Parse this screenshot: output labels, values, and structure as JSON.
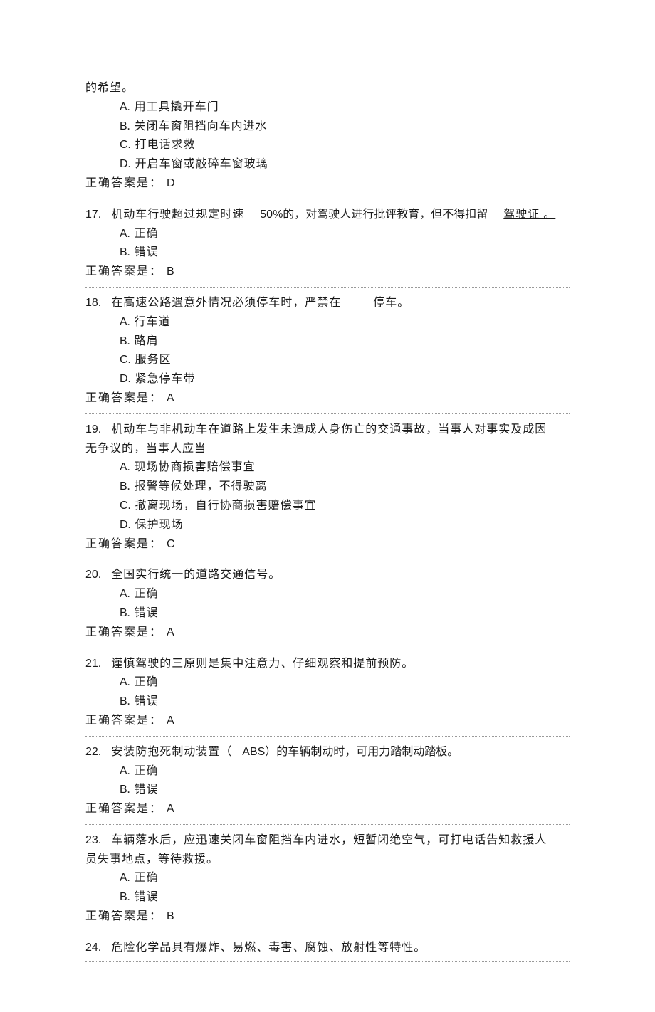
{
  "fragment_lead": "的希望。",
  "ans_label_prefix": "正确答案是：",
  "questions": [
    {
      "num": null,
      "text": "",
      "options": [
        {
          "k": "A",
          "t": "用工具撬开车门"
        },
        {
          "k": "B",
          "t": "关闭车窗阻挡向车内进水"
        },
        {
          "k": "C",
          "t": "打电话求救"
        },
        {
          "k": "D",
          "t": "开启车窗或敲碎车窗玻璃"
        }
      ],
      "answer": "D"
    },
    {
      "num": "17.",
      "text_parts": [
        "机动车行驶超过规定时速",
        "50%的，对驾驶人进行批评教育，但不得扣留",
        "驾驶证 。"
      ],
      "options": [
        {
          "k": "A",
          "t": "正确"
        },
        {
          "k": "B",
          "t": "错误"
        }
      ],
      "answer": "B"
    },
    {
      "num": "18.",
      "text": "在高速公路遇意外情况必须停车时，严禁在_____停车。",
      "options": [
        {
          "k": "A",
          "t": "行车道"
        },
        {
          "k": "B",
          "t": "路肩"
        },
        {
          "k": "C",
          "t": "服务区"
        },
        {
          "k": "D",
          "t": "紧急停车带"
        }
      ],
      "answer": "A"
    },
    {
      "num": "19.",
      "text": "机动车与非机动车在道路上发生未造成人身伤亡的交通事故，当事人对事实及成因",
      "text2": "无争议的，当事人应当 ____",
      "options": [
        {
          "k": "A",
          "t": "现场协商损害赔偿事宜"
        },
        {
          "k": "B",
          "t": "报警等候处理，不得驶离"
        },
        {
          "k": "C",
          "t": "撤离现场，自行协商损害赔偿事宜"
        },
        {
          "k": "D",
          "t": "保护现场"
        }
      ],
      "answer": "C"
    },
    {
      "num": "20.",
      "text": "全国实行统一的道路交通信号。",
      "options": [
        {
          "k": "A",
          "t": "正确"
        },
        {
          "k": "B",
          "t": "错误"
        }
      ],
      "answer": "A"
    },
    {
      "num": "21.",
      "text": "谨慎驾驶的三原则是集中注意力、仔细观察和提前预防。",
      "options": [
        {
          "k": "A",
          "t": "正确"
        },
        {
          "k": "B",
          "t": "错误"
        }
      ],
      "answer": "A"
    },
    {
      "num": "22.",
      "text_parts2": [
        "安装防抱死制动装置（",
        "ABS）的车辆制动时，可用力踏制动踏板。"
      ],
      "options": [
        {
          "k": "A",
          "t": "正确"
        },
        {
          "k": "B",
          "t": "错误"
        }
      ],
      "answer": "A"
    },
    {
      "num": "23.",
      "text": "车辆落水后，应迅速关闭车窗阻挡车内进水，短暂闭绝空气，可打电话告知救援人",
      "text2": "员失事地点，等待救援。",
      "options": [
        {
          "k": "A",
          "t": "正确"
        },
        {
          "k": "B",
          "t": "错误"
        }
      ],
      "answer": "B"
    },
    {
      "num": "24.",
      "text": "危险化学品具有爆炸、易燃、毒害、腐蚀、放射性等特性。",
      "options": [],
      "answer": null
    }
  ]
}
